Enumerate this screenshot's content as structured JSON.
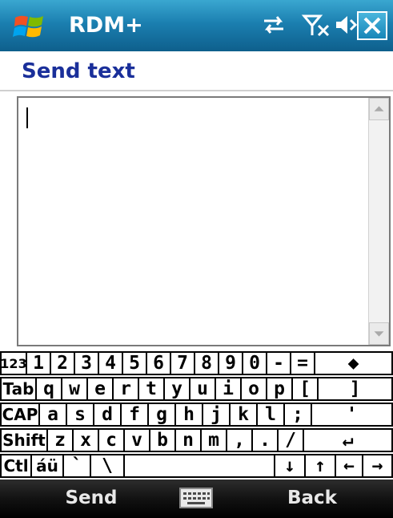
{
  "titlebar": {
    "app_title": "RDM+",
    "icons": [
      "windows-start-icon",
      "sync-icon",
      "signal-icon",
      "volume-icon",
      "close-icon"
    ]
  },
  "header": {
    "title": "Send text"
  },
  "text_area": {
    "value": ""
  },
  "keyboard": {
    "rows": [
      [
        "123",
        "1",
        "2",
        "3",
        "4",
        "5",
        "6",
        "7",
        "8",
        "9",
        "0",
        "-",
        "=",
        "◆"
      ],
      [
        "Tab",
        "q",
        "w",
        "e",
        "r",
        "t",
        "y",
        "u",
        "i",
        "o",
        "p",
        "[",
        "]"
      ],
      [
        "CAP",
        "a",
        "s",
        "d",
        "f",
        "g",
        "h",
        "j",
        "k",
        "l",
        ";",
        "'"
      ],
      [
        "Shift",
        "z",
        "x",
        "c",
        "v",
        "b",
        "n",
        "m",
        ",",
        ".",
        "/",
        "↵"
      ],
      [
        "Ctl",
        "áü",
        "`",
        "\\",
        "",
        "↓",
        "↑",
        "←",
        "→"
      ]
    ]
  },
  "menubar": {
    "left_softkey": "Send",
    "right_softkey": "Back",
    "sip_icon": "keyboard-icon"
  },
  "colors": {
    "titlebar": "#1b7fb0",
    "page_title": "#1a2f9a",
    "menubar": "#121212"
  }
}
